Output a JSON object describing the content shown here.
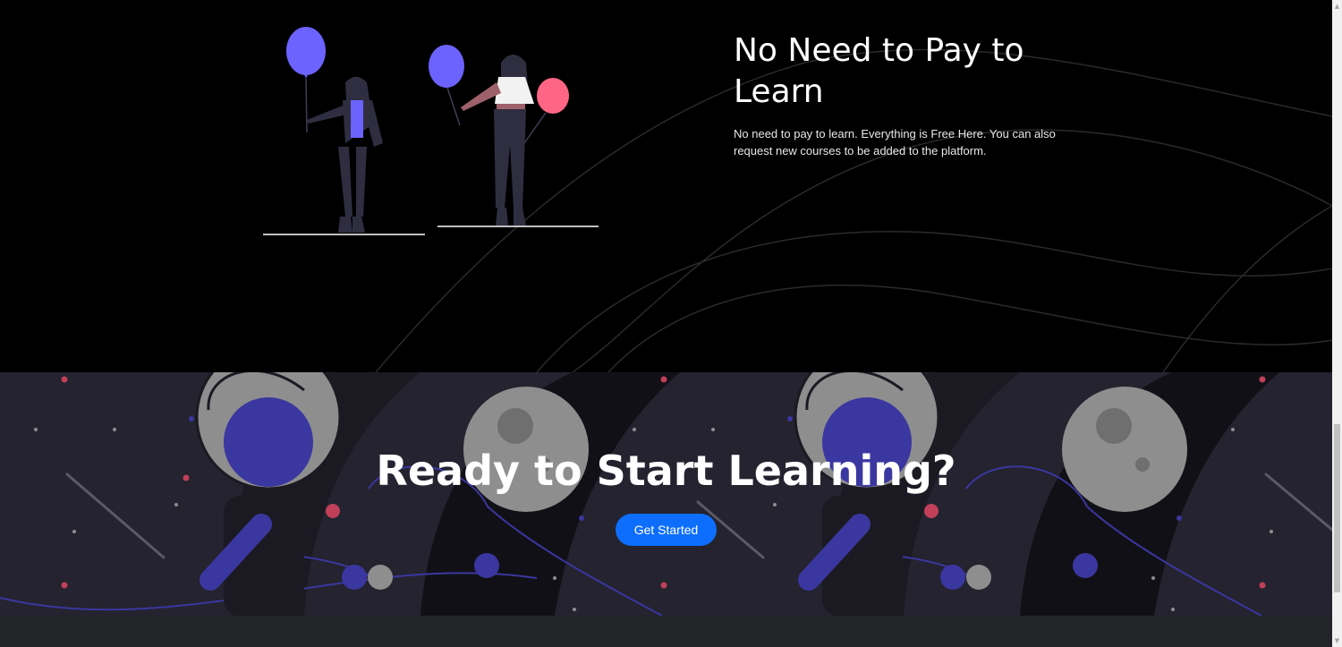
{
  "feature": {
    "title": "No Need to Pay to Learn",
    "description": "No need to pay to learn. Everything is Free Here. You can also request new courses to be added to the platform."
  },
  "cta": {
    "title": "Ready to Start Learning?",
    "button_label": "Get Started"
  },
  "colors": {
    "accent": "#0d6efd",
    "balloon_purple": "#6c63ff",
    "balloon_pink": "#ff6584",
    "cta_background": "#24232f"
  },
  "scrollbar": {
    "up_icon": "triangle-up",
    "down_icon": "triangle-down"
  }
}
